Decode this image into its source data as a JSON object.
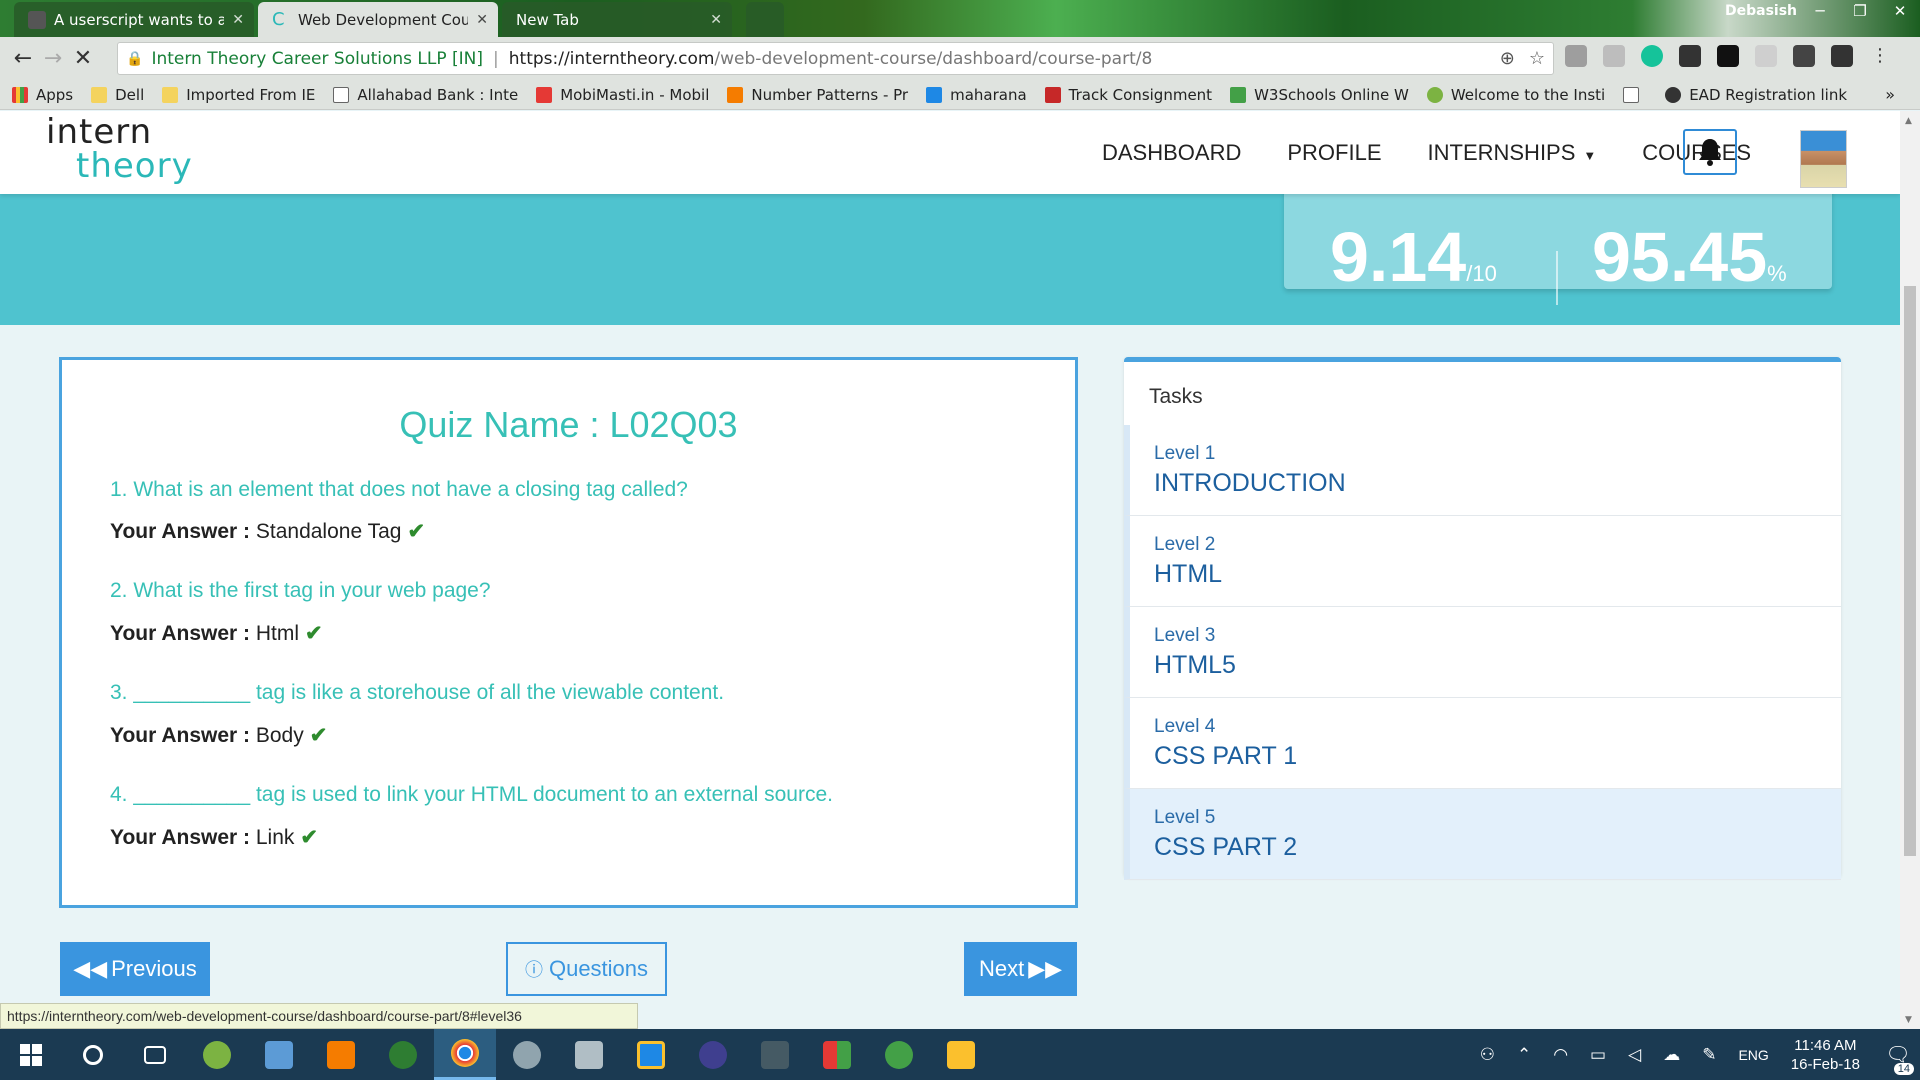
{
  "browser": {
    "tabs": [
      {
        "title": "A userscript wants to acc",
        "color": "#555555"
      },
      {
        "title": "Web Development Cours",
        "color": "#2bb8b8"
      },
      {
        "title": "New Tab",
        "color": "#888888"
      }
    ],
    "profile_name": "Debasish",
    "site_name": "Intern Theory Career Solutions LLP [IN]",
    "url_host": "https://interntheory.com",
    "url_path": "/web-development-course/dashboard/course-part/8",
    "bookmarks": [
      {
        "label": "Apps",
        "color": "#e53935"
      },
      {
        "label": "Dell",
        "color": "#f4d35e"
      },
      {
        "label": "Imported From IE",
        "color": "#f4d35e"
      },
      {
        "label": "Allahabad Bank : Inte",
        "color": "#ffffff"
      },
      {
        "label": "MobiMasti.in - Mobil",
        "color": "#e53935"
      },
      {
        "label": "Number Patterns - Pr",
        "color": "#f57c00"
      },
      {
        "label": "maharana",
        "color": "#1e88e5"
      },
      {
        "label": "Track Consignment",
        "color": "#c62828"
      },
      {
        "label": "W3Schools Online W",
        "color": "#43a047"
      },
      {
        "label": "Welcome to the Insti",
        "color": "#7cb342"
      },
      {
        "label": "EAD Registration link",
        "color": "#ffffff"
      }
    ],
    "bookmarks_more": "»"
  },
  "site": {
    "logo_line1": "intern",
    "logo_line2": "theory",
    "nav": {
      "dashboard": "DASHBOARD",
      "profile": "PROFILE",
      "internships": "INTERNSHIPS",
      "courses": "COURSES"
    }
  },
  "scores": {
    "score_value": "9.14",
    "score_unit": "/10",
    "percent_value": "95.45",
    "percent_unit": "%"
  },
  "quiz": {
    "title": "Quiz Name : L02Q03",
    "answer_label": "Your Answer :",
    "questions": [
      {
        "q": "1. What is an element that does not have a closing tag called?",
        "a": "Standalone Tag"
      },
      {
        "q": "2. What is the first tag in your web page?",
        "a": "Html"
      },
      {
        "q": "3. __________ tag is like a storehouse of all the viewable content.",
        "a": "Body"
      },
      {
        "q": "4. __________ tag is used to link your HTML document to an external source.",
        "a": "Link"
      }
    ]
  },
  "tasks": {
    "title": "Tasks",
    "levels": [
      {
        "level": "Level 1",
        "name": "INTRODUCTION"
      },
      {
        "level": "Level 2",
        "name": "HTML"
      },
      {
        "level": "Level 3",
        "name": "HTML5"
      },
      {
        "level": "Level 4",
        "name": "CSS PART 1"
      },
      {
        "level": "Level 5",
        "name": "CSS PART 2"
      }
    ]
  },
  "buttons": {
    "previous": "Previous",
    "questions": "Questions",
    "next": "Next"
  },
  "status_url": "https://interntheory.com/web-development-course/dashboard/course-part/8#level36",
  "taskbar": {
    "language": "ENG",
    "time": "11:46 AM",
    "date": "16-Feb-18",
    "notifications": "14"
  },
  "colors": {
    "accent_blue": "#3a95df",
    "accent_teal": "#37c0b6",
    "banner": "#4fc3cf"
  }
}
